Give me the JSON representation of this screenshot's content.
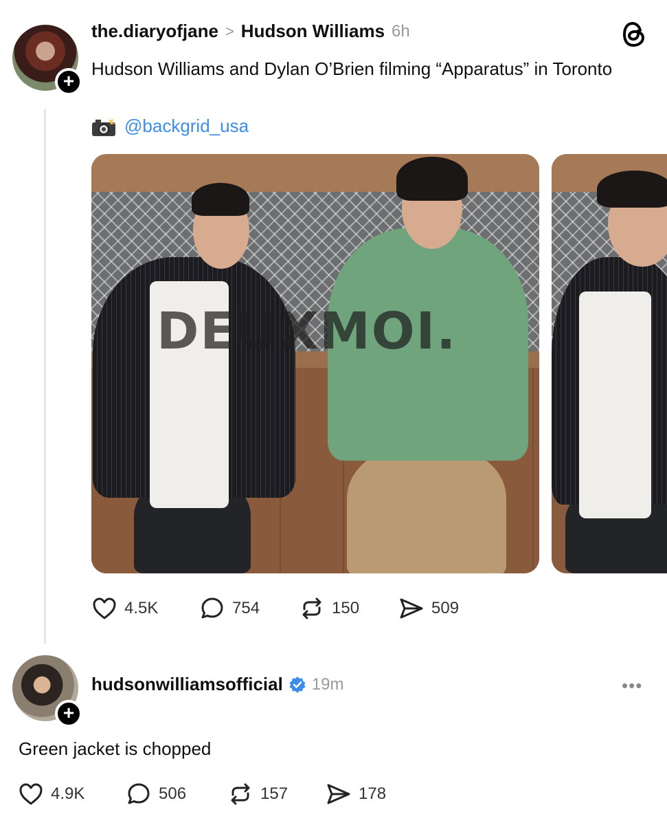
{
  "post": {
    "author": "the.diaryofjane",
    "reposted_from": "Hudson Williams",
    "time": "6h",
    "text": "Hudson Williams and Dylan O’Brien filming “Apparatus” in Toronto",
    "credit_handle": "@backgrid_usa",
    "watermark": "DEUXMOI.",
    "stats": {
      "likes": "4.5K",
      "replies": "754",
      "reposts": "150",
      "shares": "509"
    }
  },
  "reply": {
    "author": "hudsonwilliamsofficial",
    "verified": true,
    "time": "19m",
    "text": "Green jacket is chopped",
    "stats": {
      "likes": "4.9K",
      "replies": "506",
      "reposts": "157",
      "shares": "178"
    }
  },
  "colors": {
    "link": "#3b8eea",
    "muted": "#999999",
    "verified": "#3b8eea"
  },
  "icons": [
    "plus-icon",
    "chevron-right-icon",
    "threads-logo-icon",
    "camera-flash-icon",
    "heart-icon",
    "comment-icon",
    "repost-icon",
    "share-icon",
    "verified-icon",
    "more-icon"
  ]
}
